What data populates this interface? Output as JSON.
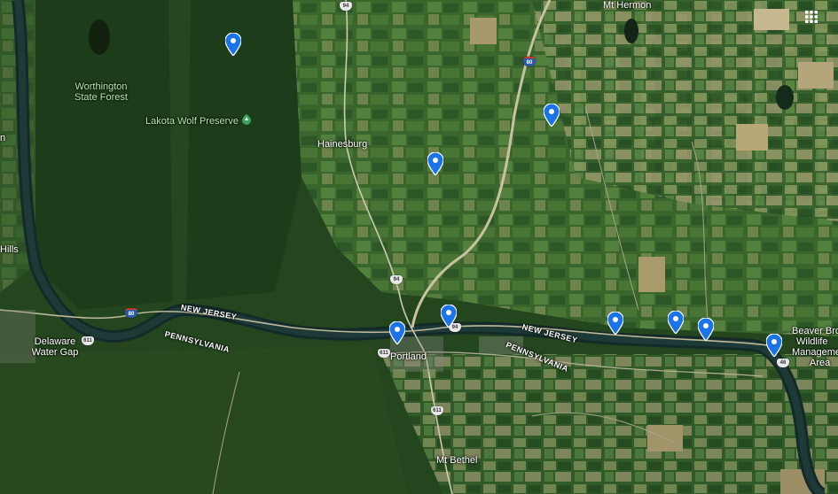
{
  "map": {
    "labels": {
      "mt_hermon": "Mt Hermon",
      "worthington_1": "Worthington",
      "worthington_2": "State Forest",
      "lakota": "Lakota Wolf Preserve",
      "hainesburg": "Hainesburg",
      "delaware_1": "Delaware",
      "delaware_2": "Water Gap",
      "portland": "Portland",
      "mt_bethel": "Mt Bethel",
      "beaver_1": "Beaver Bro",
      "beaver_2": "Wildlife",
      "beaver_3": "Manageme",
      "beaver_4": "Area",
      "hills_fragment": "Hills",
      "n_fragment": "n",
      "new_jersey_west": "NEW JERSEY",
      "pennsylvania_west": "PENNSYLVANIA",
      "new_jersey_east": "NEW JERSEY",
      "pennsylvania_east": "PENNSYLVANIA"
    },
    "shields": {
      "route_94_north": "94",
      "i80_east": "80",
      "i80_west": "80",
      "route_611": "611",
      "route_94_mid": "94",
      "route_94_portland": "94",
      "route_611_portland": "611",
      "route_611_south": "611",
      "route_46": "46"
    },
    "pin_color": "#1a73e8",
    "pin_count": 9,
    "grid_icon": "apps-grid-icon"
  }
}
